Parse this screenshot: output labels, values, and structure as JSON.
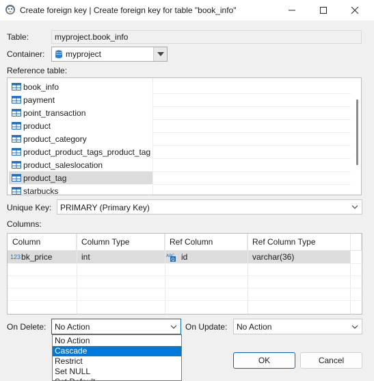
{
  "window": {
    "title": "Create foreign key | Create foreign key for table \"book_info\""
  },
  "form": {
    "table_label": "Table:",
    "table_value": "myproject.book_info",
    "container_label": "Container:",
    "container_value": "myproject",
    "reference_table_label": "Reference table:",
    "unique_key_label": "Unique Key:",
    "unique_key_value": "PRIMARY (Primary Key)",
    "columns_label": "Columns:",
    "on_delete_label": "On Delete:",
    "on_delete_value": "No Action",
    "on_update_label": "On Update:",
    "on_update_value": "No Action"
  },
  "reference_tables": [
    {
      "name": "book_info",
      "selected": false
    },
    {
      "name": "payment",
      "selected": false
    },
    {
      "name": "point_transaction",
      "selected": false
    },
    {
      "name": "product",
      "selected": false
    },
    {
      "name": "product_category",
      "selected": false
    },
    {
      "name": "product_product_tags_product_tag",
      "selected": false
    },
    {
      "name": "product_saleslocation",
      "selected": false
    },
    {
      "name": "product_tag",
      "selected": true
    },
    {
      "name": "starbucks",
      "selected": false
    }
  ],
  "columns_table": {
    "headers": [
      "Column",
      "Column Type",
      "Ref Column",
      "Ref Column Type"
    ],
    "rows": [
      {
        "column": "bk_price",
        "column_icon": "123",
        "column_type": "int",
        "ref_column": "id",
        "ref_column_type": "varchar(36)"
      }
    ]
  },
  "on_delete_options": [
    {
      "label": "No Action",
      "highlighted": false
    },
    {
      "label": "Cascade",
      "highlighted": true
    },
    {
      "label": "Restrict",
      "highlighted": false
    },
    {
      "label": "Set NULL",
      "highlighted": false
    },
    {
      "label": "Set Default",
      "highlighted": false
    }
  ],
  "buttons": {
    "ok": "OK",
    "cancel": "Cancel"
  },
  "colors": {
    "accent": "#0067c0",
    "highlight": "#0078d7",
    "selection_gray": "#dcdcdc",
    "table_icon_blue": "#1e6fc4"
  },
  "icons": {
    "app": "dbeaver-beaver-icon",
    "table": "table-grid-icon",
    "database": "database-cylinder-icon"
  }
}
